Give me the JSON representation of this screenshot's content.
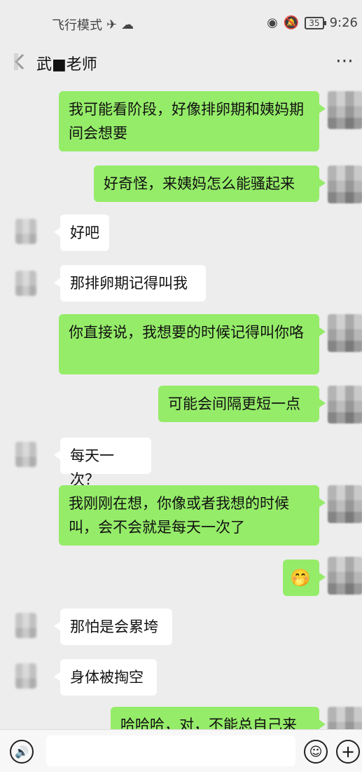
{
  "status": {
    "mode": "飞行模式",
    "airplane_icon": "✈",
    "cloud_icon": "☁",
    "eye_icon": "◉",
    "mute_icon": "🔕",
    "battery": "35",
    "time": "9:26"
  },
  "header": {
    "title": "武■老师",
    "more": "⋯"
  },
  "messages": [
    {
      "side": "right",
      "text": "我可能看阶段，好像排卵期和姨妈期间会想要"
    },
    {
      "side": "right",
      "text": "好奇怪，来姨妈怎么能骚起来"
    },
    {
      "side": "left",
      "text": "好吧"
    },
    {
      "side": "left",
      "text": "那排卵期记得叫我"
    },
    {
      "side": "right",
      "text": "你直接说，我想要的时候记得叫你咯"
    },
    {
      "side": "right",
      "text": "可能会间隔更短一点"
    },
    {
      "side": "left",
      "text": "每天一次？"
    },
    {
      "side": "right",
      "text": "我刚刚在想，你像或者我想的时候叫，会不会就是每天一次了"
    },
    {
      "side": "right",
      "text": "🤭"
    },
    {
      "side": "left",
      "text": "那怕是会累垮"
    },
    {
      "side": "left",
      "text": "身体被掏空"
    },
    {
      "side": "right",
      "text": "哈哈哈，对，不能总自己来"
    }
  ],
  "input": {
    "voice_icon": "🔊",
    "emoji_icon": "☺",
    "plus_icon": "+"
  },
  "colors": {
    "background": "#ededed",
    "right_bubble": "#95ec69",
    "left_bubble": "#ffffff"
  }
}
